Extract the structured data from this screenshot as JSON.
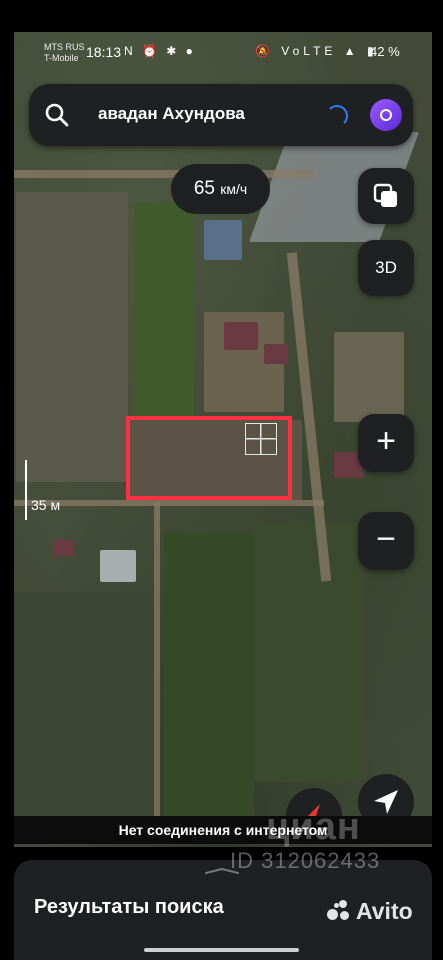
{
  "status_bar": {
    "carrier_1": "MTS RUS",
    "carrier_2": "T-Mobile",
    "time": "18:13",
    "left_icons": "N ⏰ ✱ ●",
    "right_icons": "🔕 VoLTE ▲ ▮",
    "battery": "42 %"
  },
  "search": {
    "query": "авадан Ахундова"
  },
  "speed": {
    "value": "65",
    "unit": "км/ч"
  },
  "map_controls": {
    "layers_icon": "layers-icon",
    "btn_3d": "3D",
    "zoom_in": "+",
    "zoom_out": "−",
    "compass_icon": "compass-icon",
    "location_icon": "navigation-arrow-icon"
  },
  "scale": {
    "label": "35 м"
  },
  "toast": {
    "text": "Нет соединения с интернетом"
  },
  "watermarks": {
    "cian": "циан",
    "id": "ID 312062433",
    "avito": "Avito"
  },
  "bottom_sheet": {
    "title": "Результаты поиска"
  },
  "colors": {
    "panel": "#1f2022",
    "selection": "#ff3040",
    "spinner": "#2f7bff",
    "alice": "#7b3fe4"
  }
}
